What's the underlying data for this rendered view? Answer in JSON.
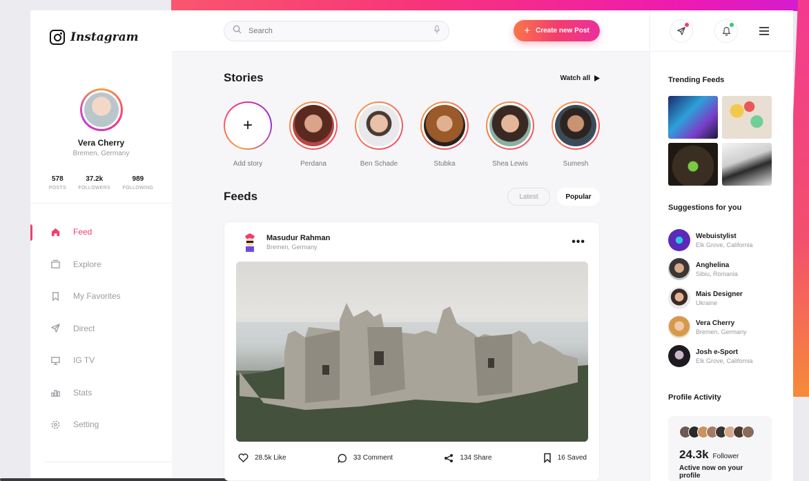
{
  "app": {
    "logo_text": "Instagram"
  },
  "profile": {
    "name": "Vera Cherry",
    "location": "Bremen, Germany",
    "stats": [
      {
        "value": "578",
        "label": "POSTS"
      },
      {
        "value": "37.2k",
        "label": "FOLLOWERS"
      },
      {
        "value": "989",
        "label": "FOLLOWING"
      }
    ]
  },
  "nav": [
    {
      "label": "Feed",
      "icon": "home-icon",
      "active": true
    },
    {
      "label": "Explore",
      "icon": "explore-icon"
    },
    {
      "label": "My Favorites",
      "icon": "bookmark-icon"
    },
    {
      "label": "Direct",
      "icon": "send-icon"
    },
    {
      "label": "IG TV",
      "icon": "tv-icon"
    },
    {
      "label": "Stats",
      "icon": "stats-icon"
    },
    {
      "label": "Setting",
      "icon": "gear-icon"
    }
  ],
  "search": {
    "placeholder": "Search"
  },
  "create_button": {
    "label": "Create new Post"
  },
  "stories": {
    "title": "Stories",
    "watch_all": "Watch all",
    "items": [
      {
        "label": "Add story",
        "add": true
      },
      {
        "label": "Perdana"
      },
      {
        "label": "Ben Schade"
      },
      {
        "label": "Stubka"
      },
      {
        "label": "Shea Lewis"
      },
      {
        "label": "Sumesh"
      }
    ]
  },
  "feeds": {
    "title": "Feeds",
    "tabs": [
      "Latest",
      "Popular"
    ],
    "selected_tab": "Popular"
  },
  "post": {
    "author": "Masudur Rahman",
    "location": "Bremen, Germany",
    "actions": {
      "like": "28.5k Like",
      "comment": "33 Comment",
      "share": "134 Share",
      "saved": "16 Saved"
    }
  },
  "right": {
    "trending_title": "Trending Feeds",
    "suggestions_title": "Suggestions for you",
    "suggestions": [
      {
        "name": "Webuistylist",
        "sub": "Elk Grove, California"
      },
      {
        "name": "Anghelina",
        "sub": "Sibiu, Romania"
      },
      {
        "name": "Mais Designer",
        "sub": "Ukraine"
      },
      {
        "name": "Vera Cherry",
        "sub": "Bremen, Germany"
      },
      {
        "name": "Josh e-Sport",
        "sub": "Elk Grove, California"
      }
    ],
    "activity_title": "Profile Activity",
    "activity": {
      "count": "24.3k",
      "count_label": "Follower",
      "sub": "Active now on your profile"
    }
  },
  "colors": {
    "accent": "#f33d6c",
    "notification_dot_send": "#f33d6c",
    "notification_dot_bell": "#2ecc71"
  }
}
